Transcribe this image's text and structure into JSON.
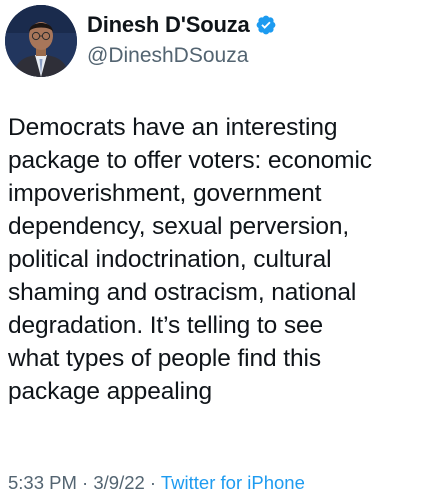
{
  "author": {
    "display_name": "Dinesh D'Souza",
    "handle": "@DineshDSouza",
    "verified_icon": "verified-badge-icon",
    "avatar_icon": "avatar-photo"
  },
  "tweet": {
    "text": "Democrats have an interesting\npackage to offer voters: economic\nimpoverishment, government\ndependency, sexual perversion,\npolitical indoctrination, cultural\nshaming and ostracism, national\ndegradation. It’s telling to see\nwhat types of people find this\npackage appealing"
  },
  "meta": {
    "time": "5:33 PM",
    "separator_1": " · ",
    "date": "3/9/22",
    "separator_2": " · ",
    "source": "Twitter for iPhone"
  },
  "colors": {
    "text": "#0f1419",
    "secondary": "#536471",
    "accent": "#1d9bf0"
  }
}
